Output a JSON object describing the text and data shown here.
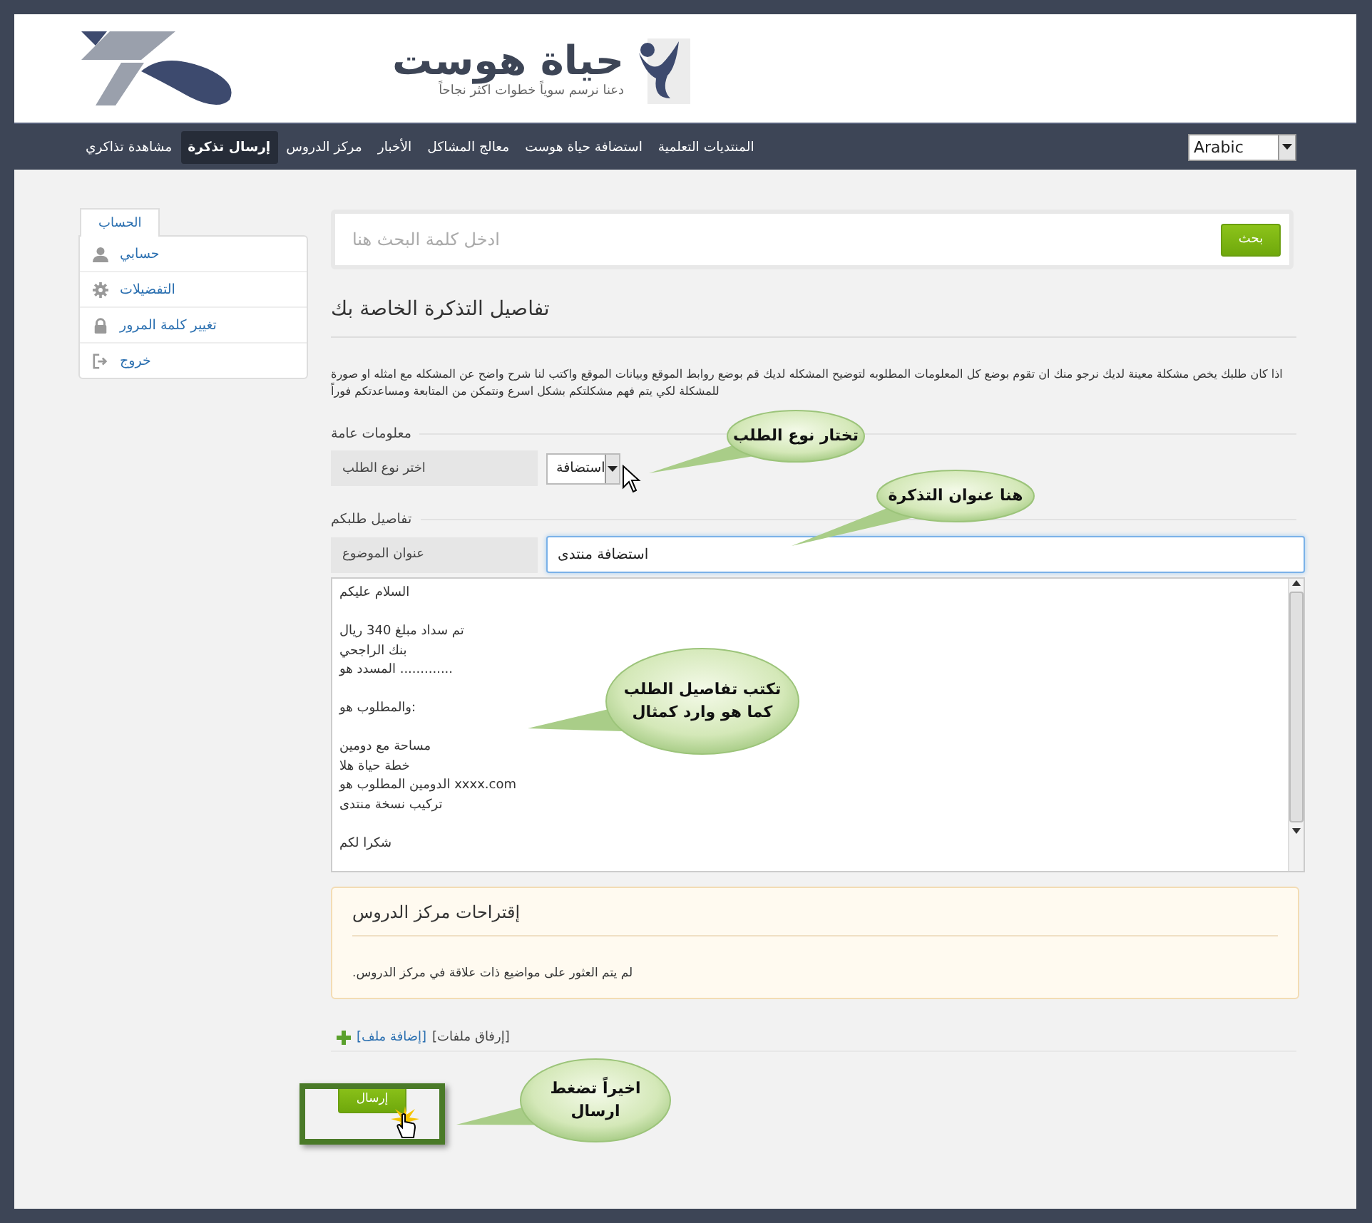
{
  "header": {
    "brand": "حياة هوست",
    "tagline": "دعنا نرسم سوياً خطوات اكثر نجاحاً"
  },
  "nav": {
    "items": [
      {
        "label": "المنتديات التعلمية",
        "selected": false
      },
      {
        "label": "استضافة حياة هوست",
        "selected": false
      },
      {
        "label": "معالج المشاكل",
        "selected": false
      },
      {
        "label": "الأخبار",
        "selected": false
      },
      {
        "label": "مركز الدروس",
        "selected": false
      },
      {
        "label": "إرسال تذكرة",
        "selected": true
      },
      {
        "label": "مشاهدة تذاكري",
        "selected": false
      }
    ],
    "language": "Arabic"
  },
  "sidebar": {
    "tab": "الحساب",
    "items": [
      {
        "label": "حسابي"
      },
      {
        "label": "التفضيلات"
      },
      {
        "label": "تغيير كلمة المرور"
      },
      {
        "label": "خروج"
      }
    ]
  },
  "search": {
    "placeholder": "ادخل كلمة البحث هنا",
    "button": "بحث"
  },
  "form": {
    "title": "تفاصيل التذكرة الخاصة بك",
    "intro": "اذا كان طلبك يخص مشكلة معينة لديك نرجو منك ان تقوم بوضع كل المعلومات المطلوبه لتوضيح المشكله لديك قم بوضع روابط الموقع وبيانات الموقع واكتب لنا شرح واضح عن المشكله مع امثله او صورة للمشكلة لكي يتم فهم مشكلتكم بشكل اسرع ونتمكن من المتابعة ومساعدتكم فوراً",
    "general_legend": "معلومات عامة",
    "type_label": "اختر نوع الطلب",
    "type_value": "استضافة",
    "details_legend": "تفاصيل طلبكم",
    "subject_label": "عنوان الموضوع",
    "subject_value": "استضافة منتدى",
    "message": [
      [
        "السلام عليكم"
      ],
      [
        "تم سداد مبلغ 340 ريال",
        "بنك الراجحي",
        "المسدد هو ............."
      ],
      [
        "والمطلوب هو:"
      ],
      [
        "مساحة مع دومين",
        "خطة حياة هلا",
        "الدومين المطلوب هو  xxxx.com",
        "تركيب نسخة منتدى"
      ],
      [
        "شكرا لكم"
      ]
    ],
    "suggestions": {
      "title": "إقتراحات مركز الدروس",
      "text": ".لم يتم العثور على مواضيع ذات علاقة في مركز الدروس"
    },
    "attach_label": "[إرفاق ملفات]",
    "attach_link": "[إضافة ملف]",
    "submit": "إرسال"
  },
  "callouts": [
    {
      "text": "تختار نوع الطلب"
    },
    {
      "text": "هنا عنوان التذكرة"
    },
    {
      "text": "تكتب تفاصيل الطلب\nكما هو وارد كمثال"
    },
    {
      "text": "اخيراً تضغط\nارسال"
    }
  ]
}
